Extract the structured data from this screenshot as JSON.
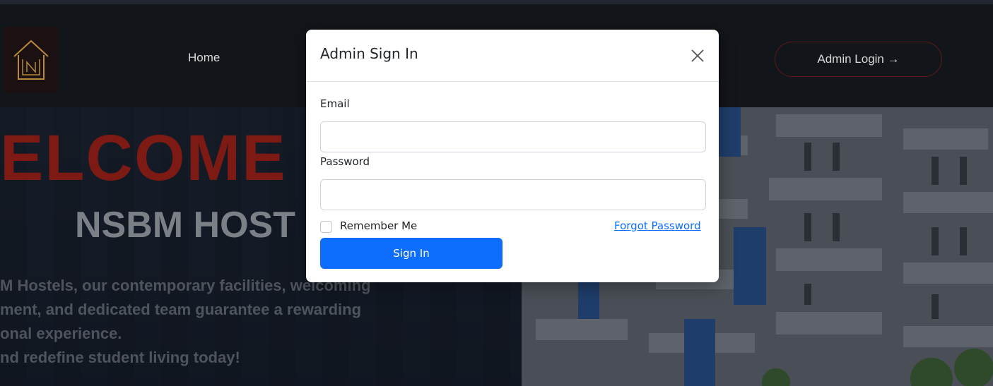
{
  "nav": {
    "logo_icon": "house-logo-icon",
    "home_label": "Home",
    "admin_login_label": "Admin Login →"
  },
  "hero": {
    "welcome": "ELCOME",
    "title": "NSBM HOST",
    "lines": [
      "M Hostels, our contemporary facilities, welcoming",
      "ment, and dedicated team guarantee a rewarding",
      "onal experience.",
      "nd redefine student living today!"
    ]
  },
  "modal": {
    "title": "Admin Sign In",
    "close_icon": "close-icon",
    "email_label": "Email",
    "email_value": "",
    "password_label": "Password",
    "password_value": "",
    "remember_label": "Remember Me",
    "forgot_label": "Forgot Password",
    "signin_label": "Sign In"
  },
  "colors": {
    "primary": "#0d6efd",
    "navbar": "#121519",
    "welcome_red": "#7e1a14",
    "logo_gold": "#b8893a"
  }
}
